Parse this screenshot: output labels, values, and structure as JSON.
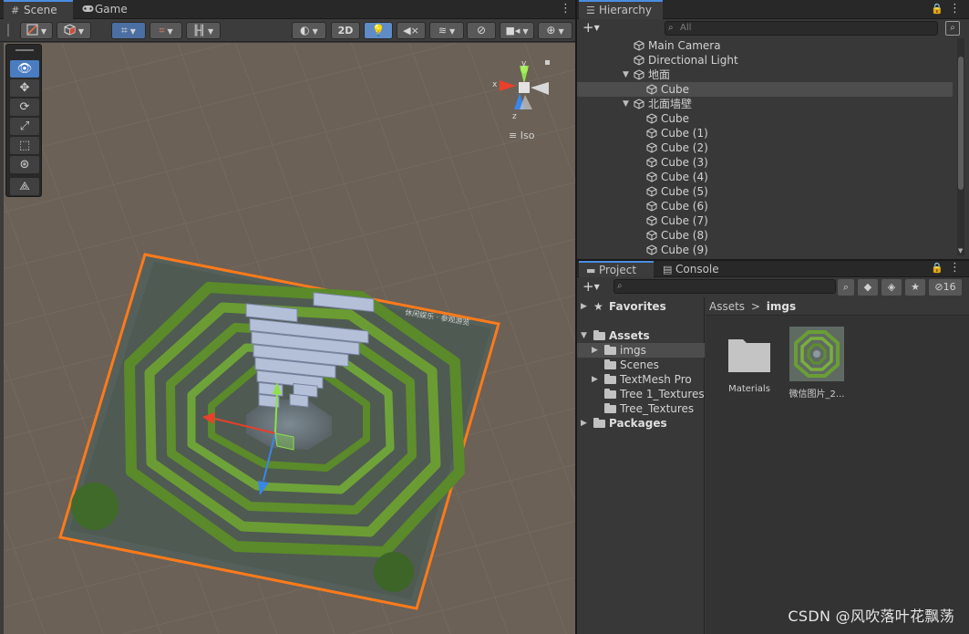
{
  "scene": {
    "tabs": [
      {
        "label": "Scene",
        "icon": "grid-icon"
      },
      {
        "label": "Game",
        "icon": "gamepad-icon"
      }
    ],
    "toolbar": {
      "mode_2d_label": "2D"
    },
    "gizmo": {
      "x_label": "x",
      "y_label": "y",
      "z_label": "z",
      "projection_label": "Iso"
    },
    "tools": [
      "view-tool",
      "move-tool",
      "rotate-tool",
      "scale-tool",
      "rect-tool",
      "transform-tool",
      "custom-tool"
    ],
    "maze_sign_text": "休闲娱乐 · 参观游览"
  },
  "hierarchy": {
    "title": "Hierarchy",
    "search_placeholder": "All",
    "items": [
      {
        "label": "Main Camera",
        "depth": 1,
        "arrow": "",
        "selected": false
      },
      {
        "label": "Directional Light",
        "depth": 1,
        "arrow": "",
        "selected": false
      },
      {
        "label": "地面",
        "depth": 1,
        "arrow": "down",
        "selected": false
      },
      {
        "label": "Cube",
        "depth": 2,
        "arrow": "",
        "selected": true
      },
      {
        "label": "北面墙壁",
        "depth": 1,
        "arrow": "down",
        "selected": false
      },
      {
        "label": "Cube",
        "depth": 2,
        "arrow": "",
        "selected": false
      },
      {
        "label": "Cube (1)",
        "depth": 2,
        "arrow": "",
        "selected": false
      },
      {
        "label": "Cube (2)",
        "depth": 2,
        "arrow": "",
        "selected": false
      },
      {
        "label": "Cube (3)",
        "depth": 2,
        "arrow": "",
        "selected": false
      },
      {
        "label": "Cube (4)",
        "depth": 2,
        "arrow": "",
        "selected": false
      },
      {
        "label": "Cube (5)",
        "depth": 2,
        "arrow": "",
        "selected": false
      },
      {
        "label": "Cube (6)",
        "depth": 2,
        "arrow": "",
        "selected": false
      },
      {
        "label": "Cube (7)",
        "depth": 2,
        "arrow": "",
        "selected": false
      },
      {
        "label": "Cube (8)",
        "depth": 2,
        "arrow": "",
        "selected": false
      },
      {
        "label": "Cube (9)",
        "depth": 2,
        "arrow": "",
        "selected": false
      }
    ]
  },
  "project": {
    "tabs": [
      {
        "label": "Project",
        "icon": "folder-icon"
      },
      {
        "label": "Console",
        "icon": "console-icon"
      }
    ],
    "hidden_count": "16",
    "tree": [
      {
        "label": "Favorites",
        "depth": 0,
        "arrow": "right",
        "icon": "star",
        "bold": true,
        "selected": false
      },
      {
        "label": "Assets",
        "depth": 0,
        "arrow": "down",
        "icon": "folder",
        "bold": true,
        "selected": false
      },
      {
        "label": "imgs",
        "depth": 1,
        "arrow": "right",
        "icon": "folder",
        "bold": false,
        "selected": true
      },
      {
        "label": "Scenes",
        "depth": 1,
        "arrow": "",
        "icon": "folder",
        "bold": false,
        "selected": false
      },
      {
        "label": "TextMesh Pro",
        "depth": 1,
        "arrow": "right",
        "icon": "folder",
        "bold": false,
        "selected": false
      },
      {
        "label": "Tree 1_Textures",
        "depth": 1,
        "arrow": "",
        "icon": "folder",
        "bold": false,
        "selected": false
      },
      {
        "label": "Tree_Textures",
        "depth": 1,
        "arrow": "",
        "icon": "folder",
        "bold": false,
        "selected": false
      },
      {
        "label": "Packages",
        "depth": 0,
        "arrow": "right",
        "icon": "folder",
        "bold": true,
        "selected": false
      }
    ],
    "breadcrumb": {
      "root": "Assets",
      "separator": ">",
      "current": "imgs"
    },
    "assets": [
      {
        "label": "Materials",
        "kind": "folder"
      },
      {
        "label": "微信图片_2...",
        "kind": "image"
      }
    ]
  },
  "watermark": "CSDN @风吹落叶花飘荡"
}
